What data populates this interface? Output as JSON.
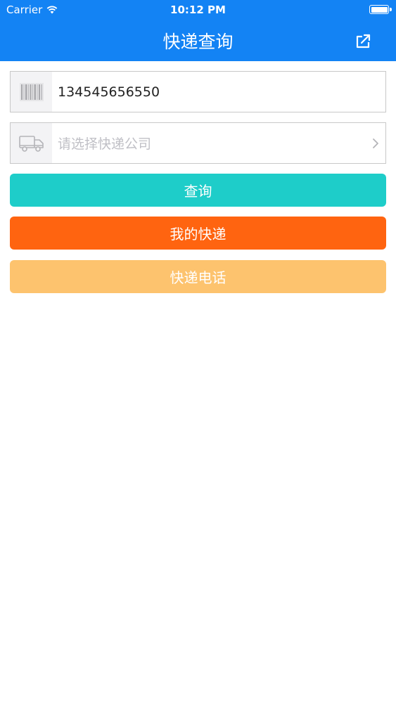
{
  "status_bar": {
    "carrier": "Carrier",
    "time": "10:12 PM"
  },
  "nav": {
    "title": "快递查询",
    "share_icon": "share-icon"
  },
  "tracking": {
    "icon": "barcode-icon",
    "value": "134545656550"
  },
  "company": {
    "icon": "truck-icon",
    "placeholder": "请选择快递公司"
  },
  "buttons": {
    "query": {
      "label": "查询",
      "color": "#1ecdc9"
    },
    "my_express": {
      "label": "我的快递",
      "color": "#ff6410"
    },
    "express_phone": {
      "label": "快递电话",
      "color": "#fdc36e"
    }
  },
  "colors": {
    "nav_bg": "#1383f4",
    "background": "#ffffff"
  }
}
